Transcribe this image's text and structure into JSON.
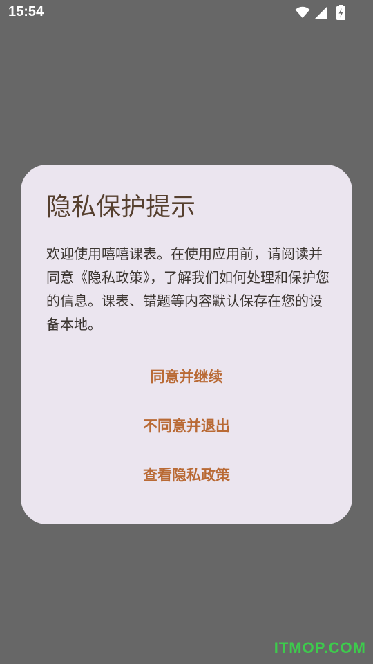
{
  "status_bar": {
    "time": "15:54",
    "icons": [
      "wifi-icon",
      "signal-icon",
      "battery-charging-icon"
    ]
  },
  "dialog": {
    "title": "隐私保护提示",
    "message": "欢迎使用嘻嘻课表。在使用应用前，请阅读并同意《隐私政策》，了解我们如何处理和保护您的信息。课表、错题等内容默认保存在您的设备本地。",
    "buttons": {
      "agree": "同意并继续",
      "disagree": "不同意并退出",
      "view_policy": "查看隐私政策"
    }
  },
  "watermark": "ITMOP.COM",
  "colors": {
    "scrim": "#676767",
    "dialog_background": "#ebe5ef",
    "title": "#56402f",
    "button_text": "#b96a35",
    "watermark": "#39d64a"
  }
}
